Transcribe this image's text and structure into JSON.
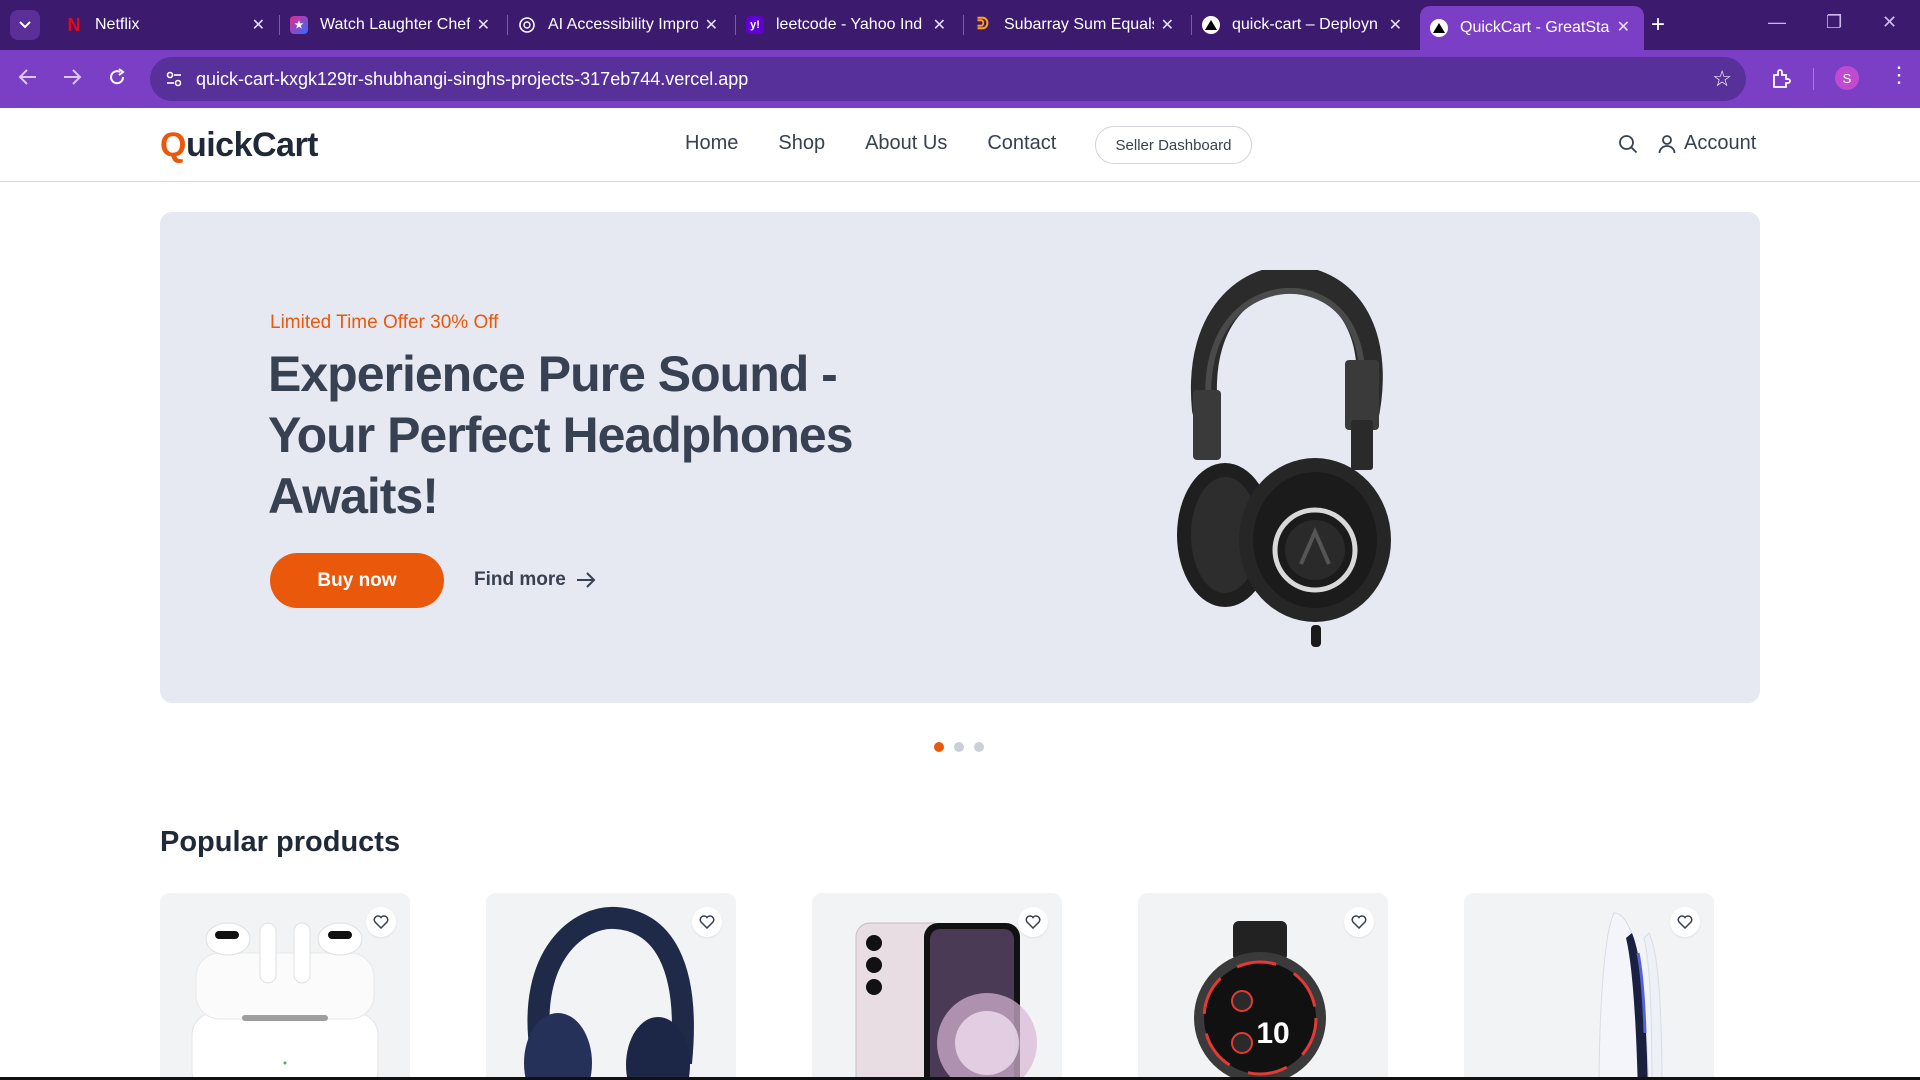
{
  "browser": {
    "tabs": [
      {
        "title": "Netflix",
        "favicon": "netflix-icon"
      },
      {
        "title": "Watch Laughter Chef",
        "favicon": "streaming-icon"
      },
      {
        "title": "AI Accessibility Impro",
        "favicon": "openai-icon"
      },
      {
        "title": "leetcode - Yahoo Ind",
        "favicon": "yahoo-icon"
      },
      {
        "title": "Subarray Sum Equals",
        "favicon": "leetcode-icon"
      },
      {
        "title": "quick-cart – Deployn",
        "favicon": "vercel-icon"
      },
      {
        "title": "QuickCart - GreatSta",
        "favicon": "vercel-icon",
        "active": true
      }
    ],
    "url": "quick-cart-kxgk129tr-shubhangi-singhs-projects-317eb744.vercel.app",
    "profile_initial": "S",
    "colors": {
      "tabbar": "#3c1a6e",
      "toolbar": "#7b3fc5",
      "omnibox": "#58309a"
    }
  },
  "site": {
    "logo_first": "Q",
    "logo_rest": "uickCart",
    "nav": {
      "home": "Home",
      "shop": "Shop",
      "about": "About Us",
      "contact": "Contact"
    },
    "seller_dashboard": "Seller Dashboard",
    "account": "Account",
    "accent_color": "#ea580c"
  },
  "hero": {
    "offer": "Limited Time Offer 30% Off",
    "headline": "Experience Pure Sound - Your Perfect Headphones Awaits!",
    "buy_now": "Buy now",
    "find_more": "Find more",
    "slide_count": 3,
    "active_slide": 1
  },
  "popular": {
    "title": "Popular products",
    "products": [
      {
        "image": "earbuds-image"
      },
      {
        "image": "headphones-image"
      },
      {
        "image": "smartphone-image"
      },
      {
        "image": "smartwatch-image"
      },
      {
        "image": "game-console-image"
      }
    ],
    "watch_face_value": "10"
  }
}
